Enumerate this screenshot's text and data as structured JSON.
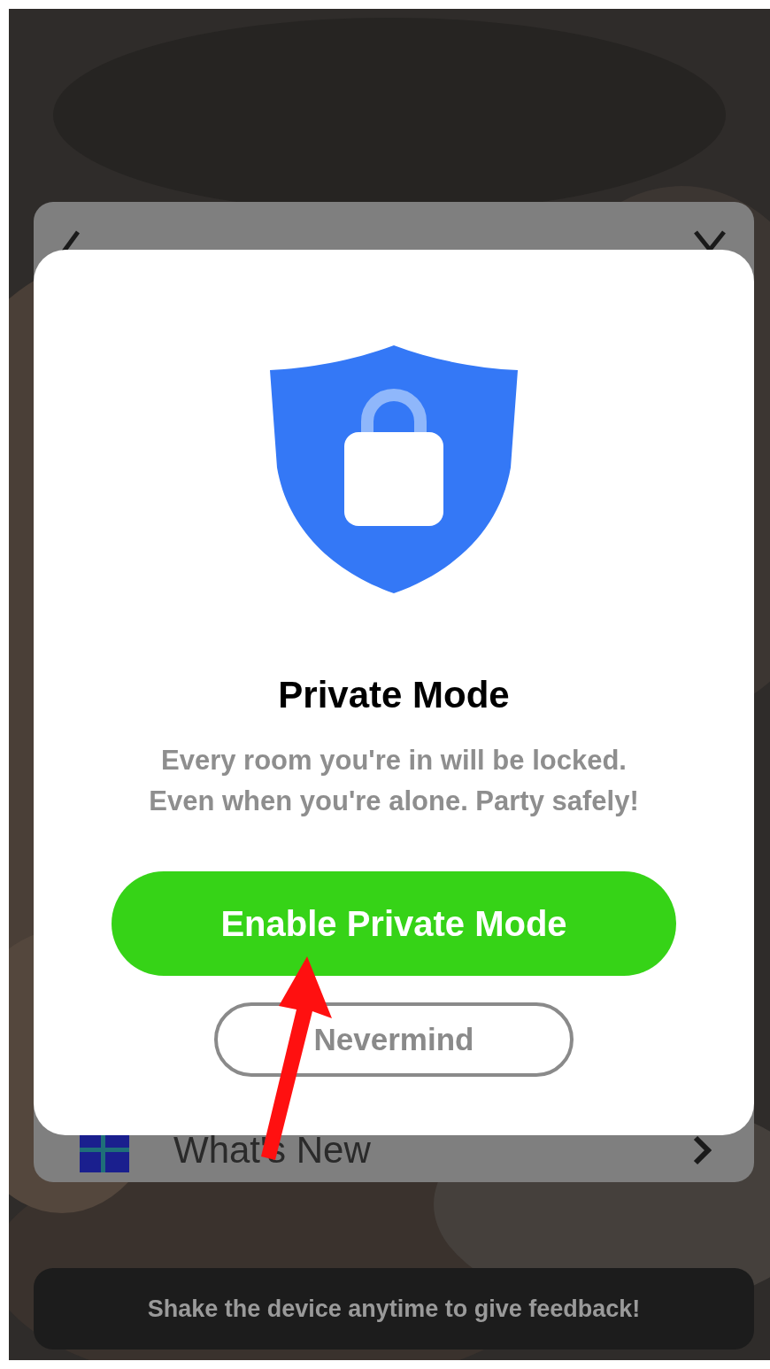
{
  "settings_panel": {
    "rows": [
      {
        "label": "What's New"
      }
    ]
  },
  "dialog": {
    "title": "Private Mode",
    "message_lines": [
      "Every room you're in will be locked.",
      "Even when you're alone. Party safely!"
    ],
    "primary_button": "Enable Private Mode",
    "secondary_button": "Nevermind"
  },
  "toast": "Shake the device anytime to give feedback!"
}
